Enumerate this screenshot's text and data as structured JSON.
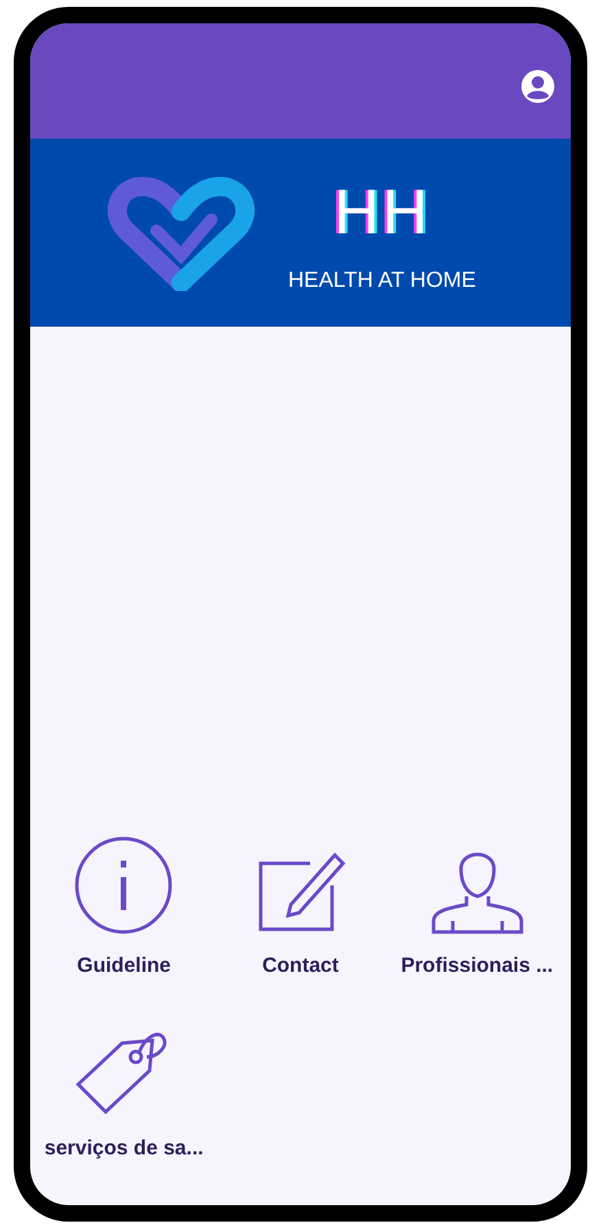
{
  "brand": {
    "title": "HH",
    "subtitle": "HEALTH AT HOME"
  },
  "tiles": [
    {
      "label": "Guideline",
      "kind": "info"
    },
    {
      "label": "Contact",
      "kind": "edit"
    },
    {
      "label": "Profissionais ...",
      "kind": "person"
    },
    {
      "label": "serviços de sa...",
      "kind": "tag"
    }
  ]
}
